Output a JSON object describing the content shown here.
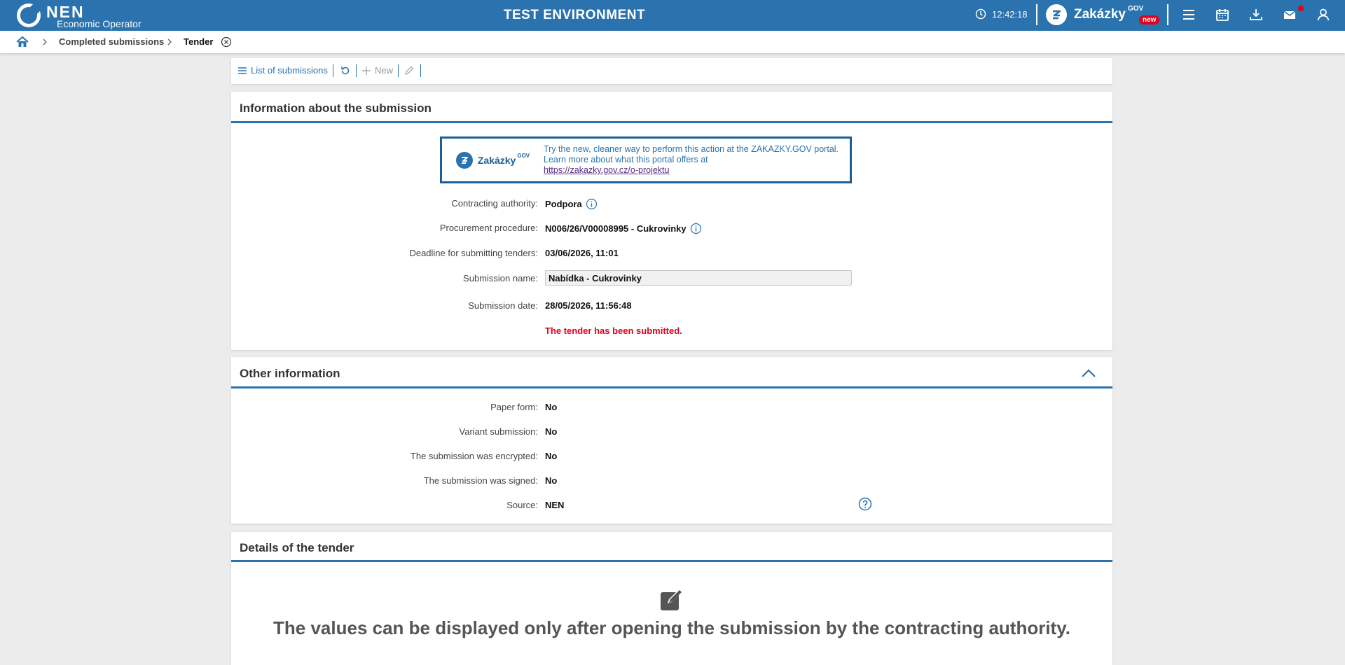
{
  "header": {
    "logo_text": "NEN",
    "logo_subtitle": "Economic Operator",
    "environment_title": "TEST ENVIRONMENT",
    "time": "12:42:18",
    "zakazky_label": "Zakázky",
    "zakazky_sup": "GOV",
    "new_badge": "new",
    "icons": [
      "menu-icon",
      "calendar-icon",
      "download-icon",
      "mail-icon",
      "user-icon"
    ]
  },
  "breadcrumb": {
    "items": [
      "Completed submissions",
      "Tender"
    ]
  },
  "toolbar": {
    "list_label": "List of submissions",
    "new_label": "New"
  },
  "info": {
    "title": "Information about the submission",
    "banner": {
      "brand": "Zakázky",
      "brand_sup": "GOV",
      "line1": "Try the new, cleaner way to perform this action at the ZAKAZKY.GOV portal.",
      "line2": "Learn more about what this portal offers at",
      "link": "https://zakazky.gov.cz/o-projektu"
    },
    "fields": {
      "contracting_authority_label": "Contracting authority:",
      "contracting_authority_value": "Podpora",
      "procedure_label": "Procurement procedure:",
      "procedure_value": "N006/26/V00008995 - Cukrovinky",
      "deadline_label": "Deadline for submitting tenders:",
      "deadline_value": "03/06/2026, 11:01",
      "name_label": "Submission name:",
      "name_value": "Nabídka - Cukrovinky",
      "date_label": "Submission date:",
      "date_value": "28/05/2026, 11:56:48"
    },
    "status_message": "The tender has been submitted."
  },
  "other": {
    "title": "Other information",
    "fields": {
      "paper_label": "Paper form:",
      "paper_value": "No",
      "variant_label": "Variant submission:",
      "variant_value": "No",
      "encrypted_label": "The submission was encrypted:",
      "encrypted_value": "No",
      "signed_label": "The submission was signed:",
      "signed_value": "No",
      "source_label": "Source:",
      "source_value": "NEN"
    }
  },
  "details": {
    "title": "Details of the tender",
    "message": "The values can be displayed only after opening the submission by the contracting authority."
  },
  "colors": {
    "brand_blue": "#2a73ae",
    "alert_red": "#e3001b"
  }
}
